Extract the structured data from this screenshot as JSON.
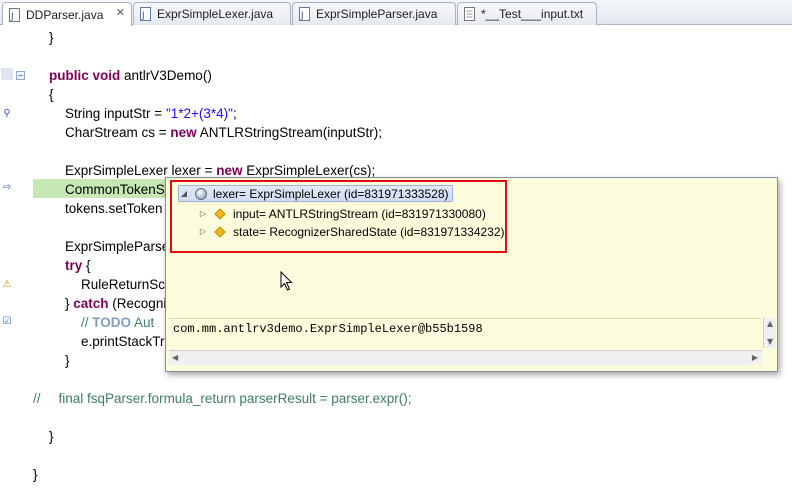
{
  "tabs": [
    {
      "label": "DDParser.java",
      "active": true,
      "closable": true
    },
    {
      "label": "ExprSimpleLexer.java",
      "active": false
    },
    {
      "label": "ExprSimpleParser.java",
      "active": false
    },
    {
      "label": "*__Test___input.txt",
      "active": false
    }
  ],
  "code": {
    "l1": "}",
    "l2_kw1": "public",
    "l2_kw2": "void",
    "l2_rest": " antlrV3Demo()",
    "l3": "{",
    "l4_a": "String inputStr = ",
    "l4_str": "\"1*2+(3*4)\"",
    "l4_b": ";",
    "l5_a": "CharStream cs = ",
    "l5_kw": "new",
    "l5_b": " ANTLRStringStream(inputStr);",
    "l6_a": "ExprSimpleLexer lexer = ",
    "l6_kw": "new",
    "l6_b": " ExprSimpleLexer(cs);",
    "l7": "CommonTokenS",
    "l8": "tokens.setToken",
    "l9": "ExprSimpleParse",
    "l10_kw": "try",
    "l10_b": " {",
    "l11": "RuleReturnSc",
    "l12_a": "} ",
    "l12_kw": "catch",
    "l12_b": " (Recogni",
    "l13_a": "// ",
    "l13_todo": "TODO",
    "l13_b": " Aut",
    "l14": "e.printStackTr",
    "l15": "}",
    "l16_a": "//",
    "l16_b": "final fsqParser.formula_return parserResult = parser.expr();",
    "l17": "}",
    "l18": "}"
  },
  "popup": {
    "root": "lexer= ExprSimpleLexer  (id=831971333528)",
    "child1": "input= ANTLRStringStream  (id=831971330080)",
    "child2": "state= RecognizerSharedState  (id=831971334232)",
    "detail": "com.mm.antlrv3demo.ExprSimpleLexer@b55b1598"
  },
  "colors": {
    "keyword": "#7f0055",
    "string": "#2a00ff",
    "comment": "#3f7f5f",
    "highlight_line": "#c7e7b4",
    "popup_bg": "#fcfcdc",
    "annotation_box": "#e01010"
  }
}
